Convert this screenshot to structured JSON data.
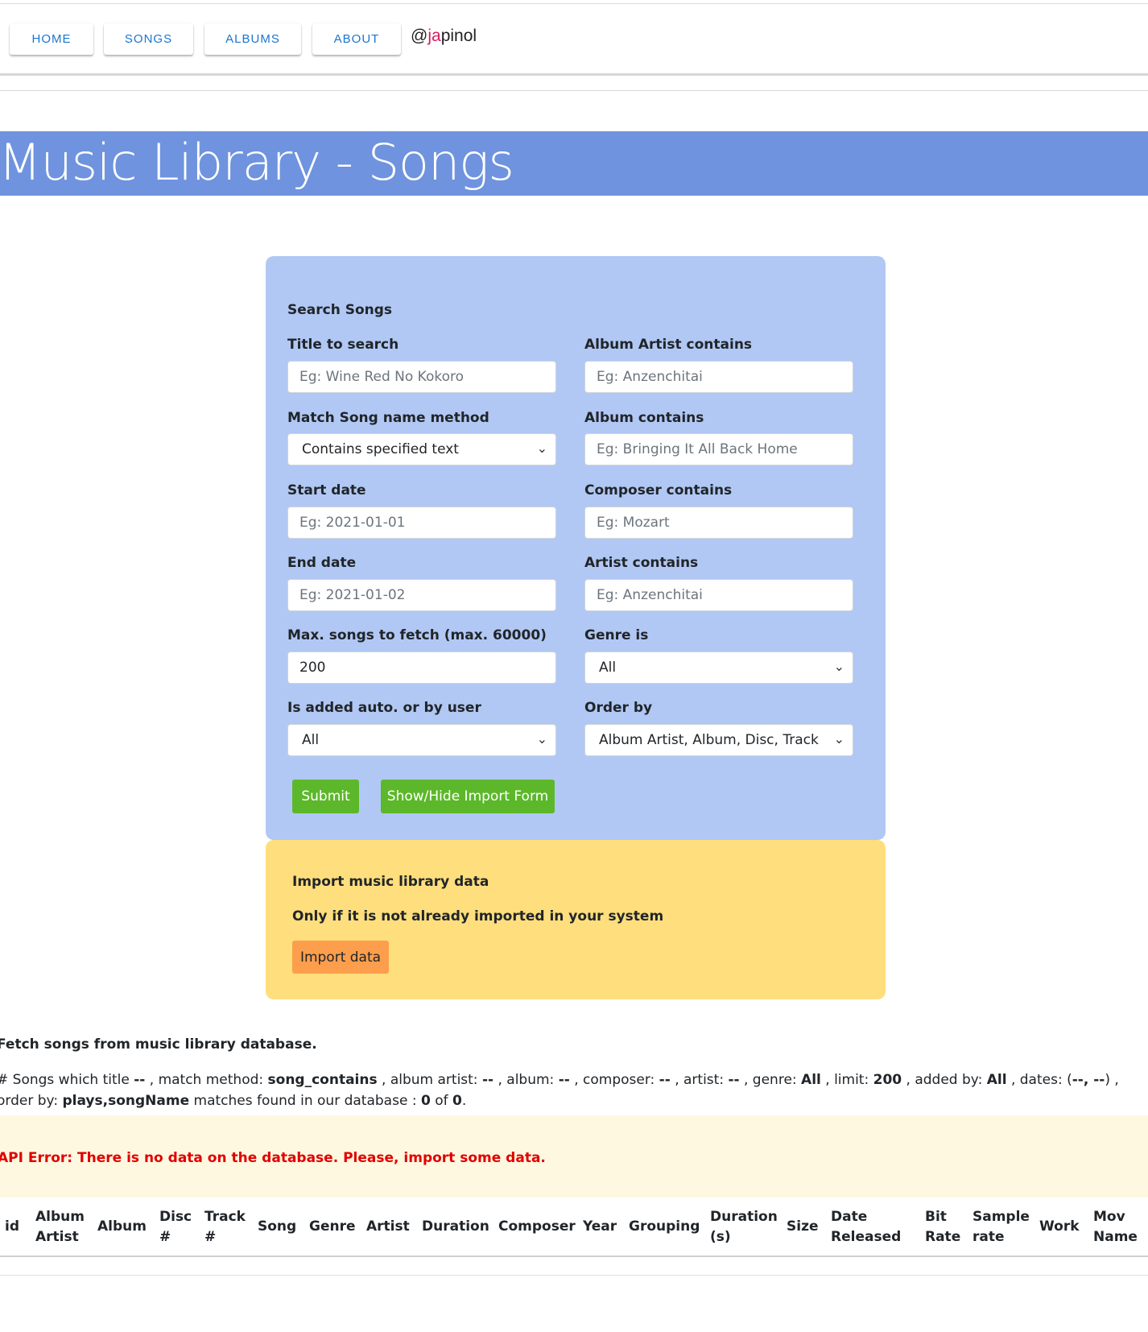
{
  "nav": {
    "items": [
      {
        "label": "HOME"
      },
      {
        "label": "SONGS"
      },
      {
        "label": "ALBUMS"
      },
      {
        "label": "ABOUT"
      }
    ],
    "brand_prefix": "@",
    "brand_accent": "ja",
    "brand_suffix": "pinol"
  },
  "hero_title": "Music Library - Songs",
  "search": {
    "heading": "Search Songs",
    "title_label": "Title to search",
    "title_placeholder": "Eg: Wine Red No Kokoro",
    "album_artist_label": "Album Artist contains",
    "album_artist_placeholder": "Eg: Anzenchitai",
    "match_label": "Match Song name method",
    "match_value": "Contains specified text",
    "album_label": "Album contains",
    "album_placeholder": "Eg: Bringing It All Back Home",
    "start_label": "Start date",
    "start_placeholder": "Eg: 2021-01-01",
    "composer_label": "Composer contains",
    "composer_placeholder": "Eg: Mozart",
    "end_label": "End date",
    "end_placeholder": "Eg: 2021-01-02",
    "artist_label": "Artist contains",
    "artist_placeholder": "Eg: Anzenchitai",
    "max_label": "Max. songs to fetch (max. 60000)",
    "max_value": "200",
    "genre_label": "Genre is",
    "genre_value": "All",
    "added_label": "Is added auto. or by user",
    "added_value": "All",
    "order_label": "Order by",
    "order_value": "Album Artist, Album, Disc, Track",
    "submit_label": "Submit",
    "toggle_import_label": "Show/Hide Import Form"
  },
  "import": {
    "title": "Import music library data",
    "subtitle": "Only if it is not already imported in your system",
    "button_label": "Import data"
  },
  "results": {
    "title": "Fetch songs from music library database.",
    "s1": "# Songs which title ",
    "v_title": "--",
    "s2": " , match method: ",
    "v_method": "song_contains",
    "s3": " , album artist: ",
    "v_album_artist": "--",
    "s4": " , album: ",
    "v_album": "--",
    "s5": " , composer: ",
    "v_composer": "--",
    "s6": " , artist: ",
    "v_artist": "--",
    "s7": " , genre: ",
    "v_genre": "All",
    "s8": " , limit: ",
    "v_limit": "200",
    "s9": " , added by: ",
    "v_added": "All",
    "s10": " , dates: (",
    "v_dates": "--, --",
    "s11": ") , order by: ",
    "v_order": "plays,songName",
    "s12": " matches found in our database : ",
    "v_found": "0",
    "s13": " of ",
    "v_total": "0",
    "s14": ".",
    "error": "API Error: There is no data on the database. Please, import some data."
  },
  "table": {
    "columns": [
      {
        "l1": "id",
        "l2": ""
      },
      {
        "l1": "Album",
        "l2": "Artist"
      },
      {
        "l1": "Album",
        "l2": ""
      },
      {
        "l1": "Disc",
        "l2": "#"
      },
      {
        "l1": "Track",
        "l2": "#"
      },
      {
        "l1": "Song",
        "l2": ""
      },
      {
        "l1": "Genre",
        "l2": ""
      },
      {
        "l1": "Artist",
        "l2": ""
      },
      {
        "l1": "Duration",
        "l2": ""
      },
      {
        "l1": "Composer",
        "l2": ""
      },
      {
        "l1": "Year",
        "l2": ""
      },
      {
        "l1": "Grouping",
        "l2": ""
      },
      {
        "l1": "Duration",
        "l2": "(s)"
      },
      {
        "l1": "Size",
        "l2": ""
      },
      {
        "l1": "Date",
        "l2": "Released"
      },
      {
        "l1": "Bit",
        "l2": "Rate"
      },
      {
        "l1": "Sample",
        "l2": "rate"
      },
      {
        "l1": "Work",
        "l2": ""
      },
      {
        "l1": "Mov",
        "l2": "Name"
      }
    ]
  }
}
